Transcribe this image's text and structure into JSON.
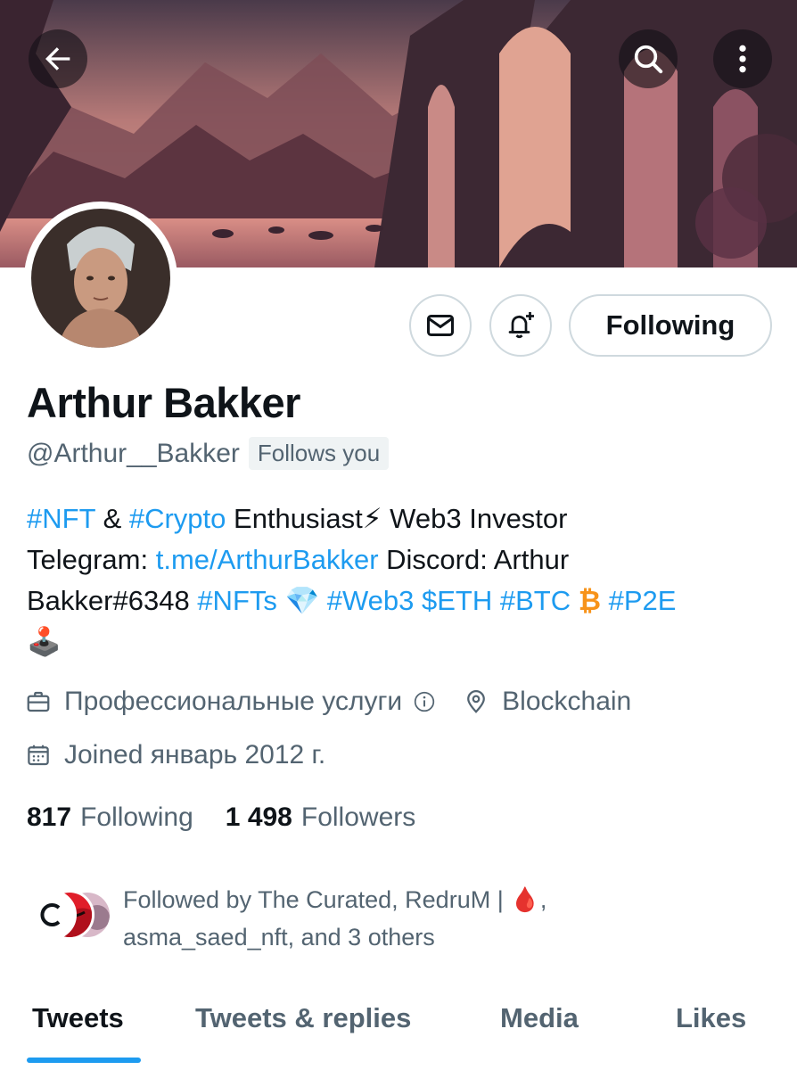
{
  "header": {
    "back_icon": "arrow-left-icon",
    "search_icon": "search-icon",
    "more_icon": "more-vertical-icon"
  },
  "actions": {
    "message_icon": "envelope-icon",
    "notify_icon": "bell-plus-icon",
    "follow_label": "Following"
  },
  "profile": {
    "name": "Arthur Bakker",
    "handle": "@Arthur__Bakker",
    "follows_you": "Follows you"
  },
  "bio": {
    "l1_tag1": "#NFT",
    "l1_amp": " & ",
    "l1_tag2": "#Crypto",
    "l1_text": " Enthusiast",
    "l1_emoji": "⚡",
    "l1_text2": " Web3 Investor",
    "l2_prefix": "Telegram: ",
    "l2_link": "t.me/ArthurBakker",
    "l2_text": " Discord: Arthur",
    "l3_text": "Bakker#6348 ",
    "l3_tag1": "#NFTs",
    "l3_emoji1": " 💎 ",
    "l3_tag2": "#Web3",
    "l3_space": " ",
    "l3_tag3": "$ETH",
    "l3_space2": " ",
    "l3_tag4": "#BTC",
    "l3_emoji2": " ₿  ",
    "l3_tag5": "#P2E",
    "l4_emoji": "🕹️"
  },
  "meta": {
    "category": "Профессиональные услуги",
    "category_icon": "briefcase-icon",
    "info_icon": "info-icon",
    "location": "Blockchain",
    "location_icon": "location-pin-icon",
    "joined": "Joined январь 2012 г.",
    "joined_icon": "calendar-icon"
  },
  "stats": {
    "following_count": "817",
    "following_label": "Following",
    "followers_count": "1 498",
    "followers_label": "Followers"
  },
  "followed_by": {
    "line1": "Followed by The Curated, RedruM | 🩸,",
    "line2": "asma_saed_nft, and 3 others"
  },
  "tabs": [
    {
      "label": "Tweets",
      "active": true
    },
    {
      "label": "Tweets & replies",
      "active": false
    },
    {
      "label": "Media",
      "active": false
    },
    {
      "label": "Likes",
      "active": false
    }
  ],
  "colors": {
    "accent": "#1d9bf0",
    "text_primary": "#0f1419",
    "text_secondary": "#536471",
    "border": "#cfd9de"
  }
}
